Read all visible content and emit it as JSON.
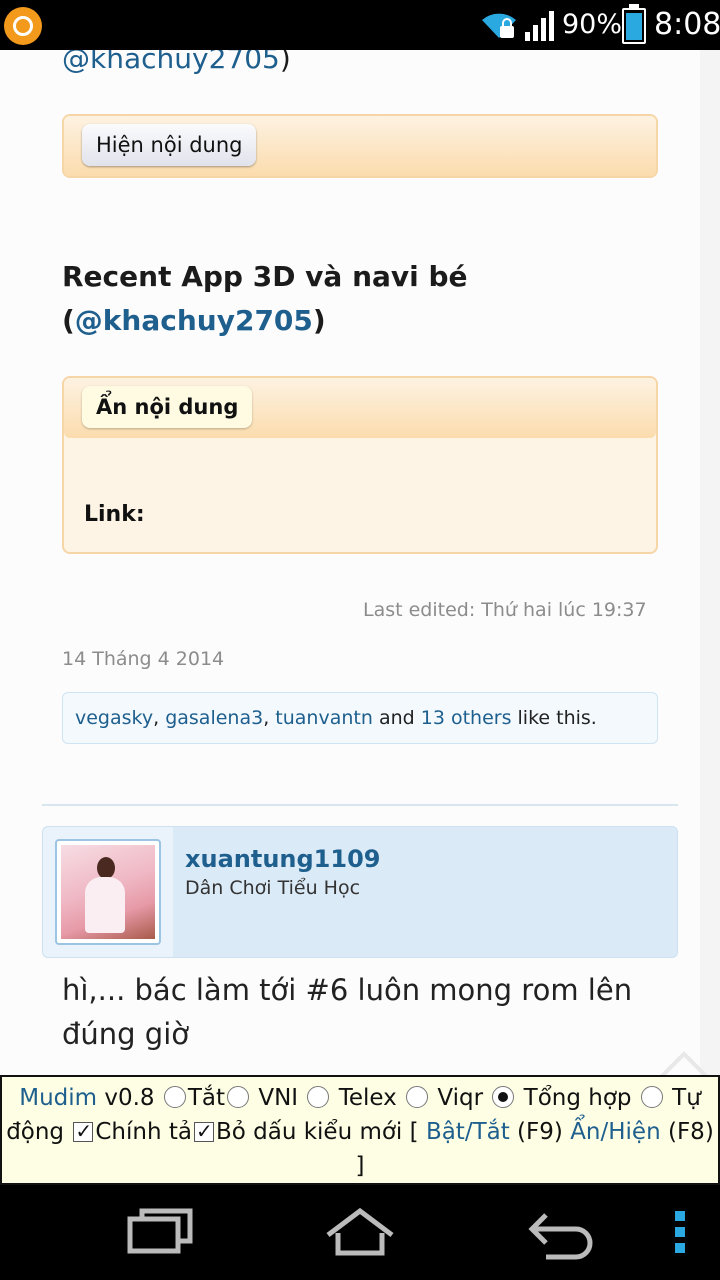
{
  "status_bar": {
    "battery_text": "90%",
    "time": "8:08",
    "battery_level": 0.9
  },
  "post_top": {
    "mention_tail": "@khachuy2705",
    "mention_close": ")",
    "spoiler1_button": "Hiện nội dung",
    "heading_line1": "Recent App 3D và navi bé",
    "heading_open": "(",
    "heading_mention": "@khachuy2705",
    "heading_close": ")",
    "spoiler2_button": "Ẩn nội dung",
    "spoiler2_content": "Link:",
    "last_edited": "Last edited: Thứ hai lúc 19:37",
    "date": "14 Tháng 4 2014",
    "likes": {
      "user1": "vegasky",
      "sep1": ", ",
      "user2": "gasalena3",
      "sep2": ", ",
      "user3": "tuanvantn",
      "and": " and ",
      "others": "13 others",
      "suffix": " like this."
    }
  },
  "next_post": {
    "author_name": "xuantung1109",
    "author_title": "Dân Chơi Tiểu Học",
    "body": "hì,... bác làm tới #6 luôn mong rom lên đúng giờ"
  },
  "mudim": {
    "name": "Mudim",
    "version": " v0.8 ",
    "opt_off": "Tắt",
    "opt_vni": " VNI ",
    "opt_telex": " Telex ",
    "opt_viqr": " Viqr ",
    "opt_combined": " Tổng hợp ",
    "opt_auto": " Tự động ",
    "check_spell": "Chính tả",
    "check_newstyle": "Bỏ dấu kiểu mới",
    "bracket_open": " [ ",
    "toggle_link": "Bật/Tắt",
    "toggle_key": " (F9) ",
    "showhide_link": "Ẩn/Hiện",
    "showhide_key": " (F8) ",
    "bracket_close": "]",
    "selected_mode": "Tổng hợp"
  },
  "icons": {
    "status_app": "app-notification-icon",
    "wifi": "wifi-icon",
    "signal": "signal-icon",
    "battery": "battery-icon",
    "scroll_up": "chevron-up-icon",
    "recent": "recent-apps-icon",
    "home": "home-icon",
    "back": "back-icon",
    "menu": "overflow-menu-icon"
  },
  "colors": {
    "link": "#1e5f8e",
    "spoiler_border": "#f6d6a6",
    "author_card": "#dbeaf7",
    "mudim_bg": "#fefee5",
    "battery_fill": "#2aa8e0"
  }
}
